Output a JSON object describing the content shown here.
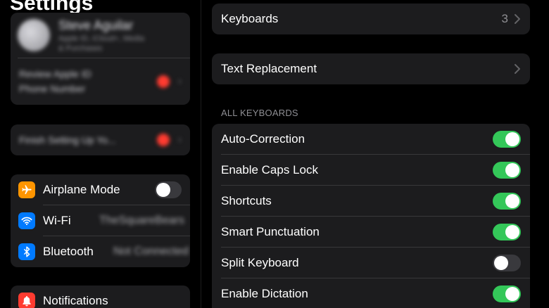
{
  "sidebar": {
    "title": "Settings",
    "profile": {
      "name": "Steve Aguilar",
      "subtitle_line1": "Apple ID, iCloud+, Media",
      "subtitle_line2": "& Purchases"
    },
    "apple_id_notice": {
      "line1": "Review Apple ID",
      "line2": "Phone Number"
    },
    "finish_setup": {
      "label": "Finish Setting Up Yo..."
    },
    "connectivity": [
      {
        "label": "Airplane Mode",
        "icon": "airplane-icon",
        "icon_color": "#ff9500",
        "toggle": "off"
      },
      {
        "label": "Wi-Fi",
        "icon": "wifi-icon",
        "icon_color": "#007aff",
        "value": "TheSquareBears"
      },
      {
        "label": "Bluetooth",
        "icon": "bluetooth-icon",
        "icon_color": "#007aff",
        "value": "Not Connected"
      }
    ],
    "notifications": {
      "label": "Notifications",
      "icon": "bell-icon",
      "icon_color": "#ff3b30"
    }
  },
  "detail": {
    "keyboards": {
      "label": "Keyboards",
      "value": "3"
    },
    "text_replacement": {
      "label": "Text Replacement"
    },
    "section_header": "ALL KEYBOARDS",
    "toggles": [
      {
        "label": "Auto-Correction",
        "state": "on"
      },
      {
        "label": "Enable Caps Lock",
        "state": "on"
      },
      {
        "label": "Shortcuts",
        "state": "on"
      },
      {
        "label": "Smart Punctuation",
        "state": "on"
      },
      {
        "label": "Split Keyboard",
        "state": "off"
      },
      {
        "label": "Enable Dictation",
        "state": "on"
      }
    ]
  },
  "colors": {
    "accent_green": "#34c759",
    "badge_red": "#ff3b30",
    "background": "#000000",
    "cell": "#1c1c1e"
  }
}
